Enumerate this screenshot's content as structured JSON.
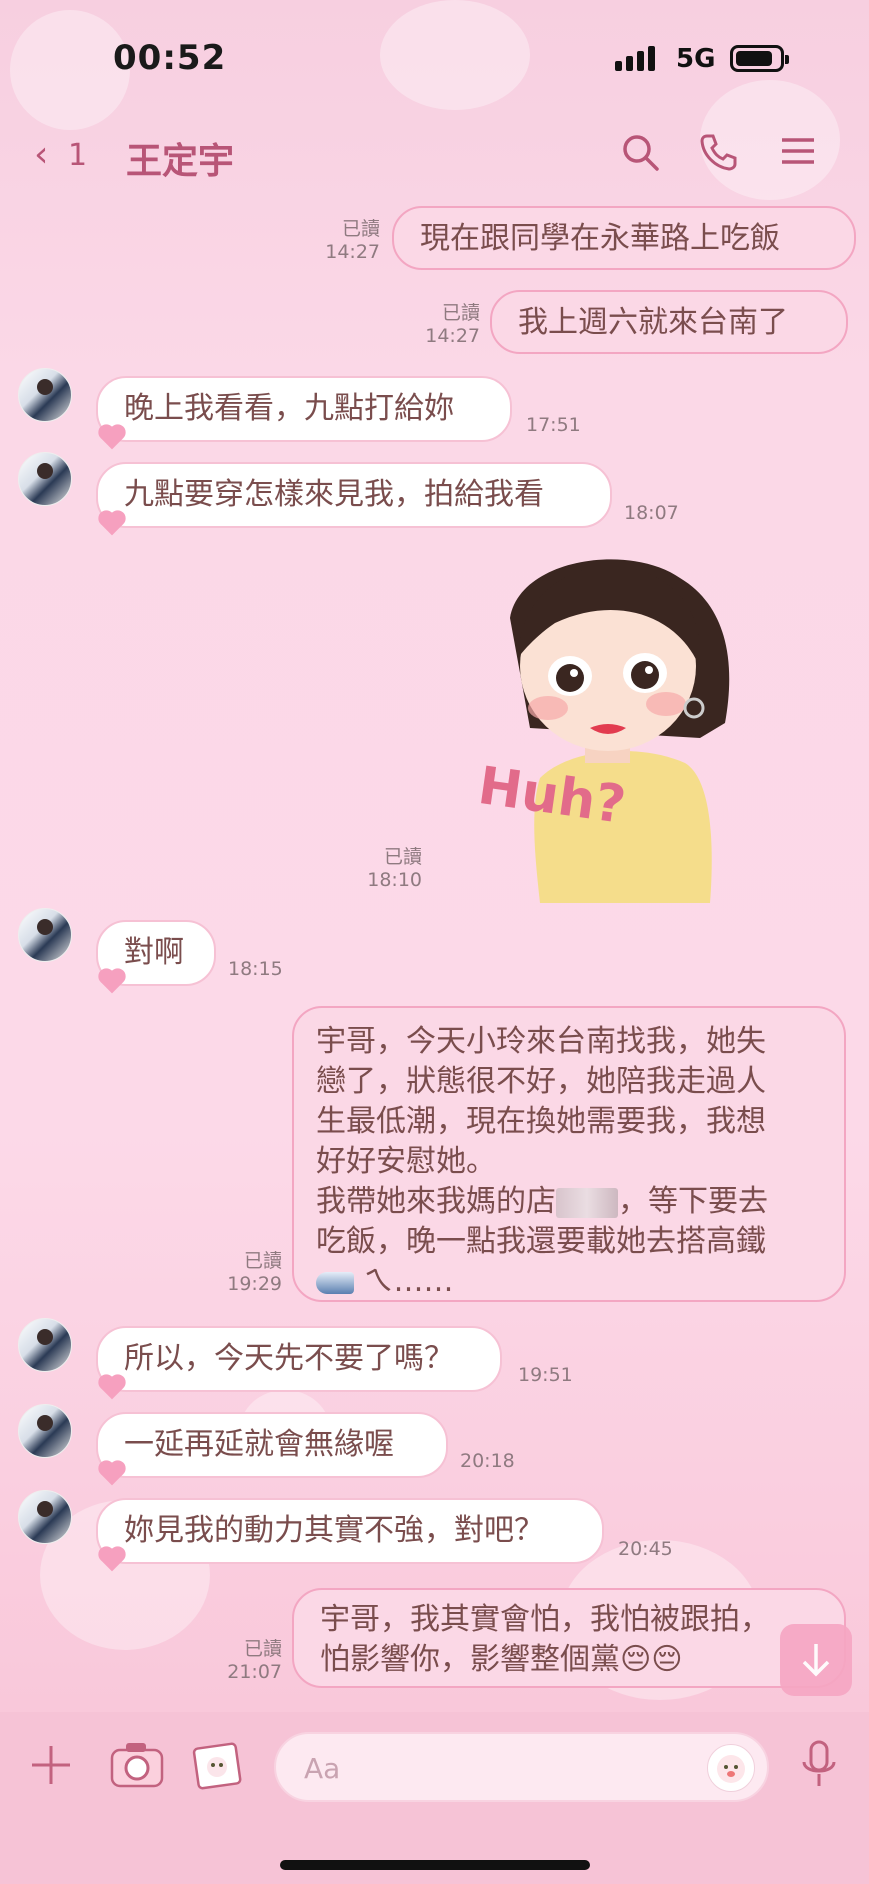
{
  "status": {
    "time": "00:52",
    "network": "5G"
  },
  "nav": {
    "back_count": "1",
    "title": "王定宇"
  },
  "messages": [
    {
      "text": "現在跟同學在永華路上吃飯",
      "read": "已讀",
      "time": "14:27"
    },
    {
      "text": "我上週六就來台南了",
      "read": "已讀",
      "time": "14:27"
    },
    {
      "text": "晚上我看看，九點打給妳",
      "time": "17:51"
    },
    {
      "text": "九點要穿怎樣來見我，拍給我看",
      "time": "18:07"
    },
    {
      "sticker_text": "Huh?",
      "read": "已讀",
      "time": "18:10"
    },
    {
      "text": "對啊",
      "time": "18:15"
    },
    {
      "line1": "宇哥，今天小玲來台南找我，她失",
      "line2": "戀了，狀態很不好，她陪我走過人",
      "line3": "生最低潮，現在換她需要我，我想",
      "line4": "好好安慰她。",
      "line5a": "我帶她來我媽的店",
      "line5b": "，等下要去",
      "line6": "吃飯，晚一點我還要載她去搭高鐵",
      "line7": "ㄟ……",
      "read": "已讀",
      "time": "19:29"
    },
    {
      "text": "所以，今天先不要了嗎？",
      "time": "19:51"
    },
    {
      "text": "一延再延就會無緣喔",
      "time": "20:18"
    },
    {
      "text": "妳見我的動力其實不強，對吧？",
      "time": "20:45"
    },
    {
      "line1": "宇哥，我其實會怕，我怕被跟拍，",
      "line2": "怕影響你，影響整個黨😔😔",
      "read": "已讀",
      "time": "21:07"
    }
  ],
  "composer": {
    "placeholder": "Aa"
  }
}
